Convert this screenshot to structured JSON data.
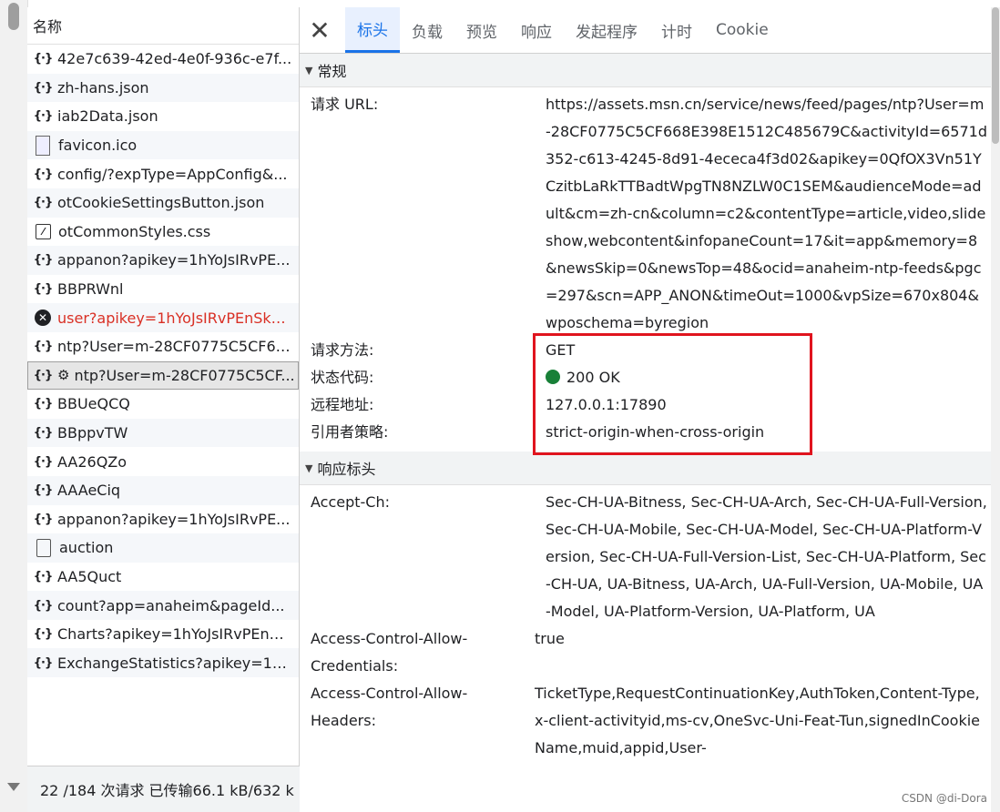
{
  "request_list": {
    "header": "名称",
    "items": [
      {
        "icon": "braces-icon",
        "name": "42e7c639-42ed-4e0f-936c-e7f..."
      },
      {
        "icon": "braces-icon",
        "name": "zh-hans.json"
      },
      {
        "icon": "braces-icon",
        "name": "iab2Data.json"
      },
      {
        "icon": "favicon-file-icon",
        "name": "favicon.ico"
      },
      {
        "icon": "braces-icon",
        "name": "config/?expType=AppConfig&..."
      },
      {
        "icon": "braces-icon",
        "name": "otCookieSettingsButton.json"
      },
      {
        "icon": "css-file-icon",
        "name": "otCommonStyles.css"
      },
      {
        "icon": "braces-icon",
        "name": "appanon?apikey=1hYoJsIRvPE..."
      },
      {
        "icon": "braces-icon",
        "name": "BBPRWnl"
      },
      {
        "icon": "error-icon",
        "name": "user?apikey=1hYoJsIRvPEnSkk...",
        "error": true
      },
      {
        "icon": "braces-icon",
        "name": "ntp?User=m-28CF0775C5CF66..."
      },
      {
        "icon": "braces-icon",
        "name": "ntp?User=m-28CF0775C5CF...",
        "selected": true,
        "gear": "⚙"
      },
      {
        "icon": "braces-icon",
        "name": "BBUeQCQ"
      },
      {
        "icon": "braces-icon",
        "name": "BBppvTW"
      },
      {
        "icon": "braces-icon",
        "name": "AA26QZo"
      },
      {
        "icon": "braces-icon",
        "name": "AAAeCiq"
      },
      {
        "icon": "braces-icon",
        "name": "appanon?apikey=1hYoJsIRvPE..."
      },
      {
        "icon": "document-icon",
        "name": "auction"
      },
      {
        "icon": "braces-icon",
        "name": "AA5Quct"
      },
      {
        "icon": "braces-icon",
        "name": "count?app=anaheim&pageId..."
      },
      {
        "icon": "braces-icon",
        "name": "Charts?apikey=1hYoJsIRvPEnS..."
      },
      {
        "icon": "braces-icon",
        "name": "ExchangeStatistics?apikey=1hY..."
      }
    ],
    "footer": "22 /184 次请求  已传输66.1 kB/632 k"
  },
  "tabs": [
    "标头",
    "负载",
    "预览",
    "响应",
    "发起程序",
    "计时",
    "Cookie"
  ],
  "active_tab": "标头",
  "general": {
    "title": "常规",
    "rows": [
      {
        "key": "请求 URL:",
        "value": "https://assets.msn.cn/service/news/feed/pages/ntp?User=m-28CF0775C5CF668E398E1512C485679C&activityId=6571d352-c613-4245-8d91-4ececa4f3d02&apikey=0QfOX3Vn51YCzitbLaRkTTBadtWpgTN8NZLW0C1SEM&audienceMode=adult&cm=zh-cn&column=c2&contentType=article,video,slideshow,webcontent&infopaneCount=17&it=app&memory=8&newsSkip=0&newsTop=48&ocid=anaheim-ntp-feeds&pgc=297&scn=APP_ANON&timeOut=1000&vpSize=670x804&wposchema=byregion"
      },
      {
        "key": "请求方法:",
        "value": "GET"
      },
      {
        "key": "状态代码:",
        "value": "200 OK",
        "status_color": "#188038"
      },
      {
        "key": "远程地址:",
        "value": "127.0.0.1:17890"
      },
      {
        "key": "引用者策略:",
        "value": "strict-origin-when-cross-origin"
      }
    ]
  },
  "response_headers": {
    "title": "响应标头",
    "rows": [
      {
        "key": "Accept-Ch:",
        "value": "Sec-CH-UA-Bitness, Sec-CH-UA-Arch, Sec-CH-UA-Full-Version, Sec-CH-UA-Mobile, Sec-CH-UA-Model, Sec-CH-UA-Platform-Version, Sec-CH-UA-Full-Version-List, Sec-CH-UA-Platform, Sec-CH-UA, UA-Bitness, UA-Arch, UA-Full-Version, UA-Mobile, UA-Model, UA-Platform-Version, UA-Platform, UA"
      },
      {
        "key": "Access-Control-Allow-Credentials:",
        "value": "true"
      },
      {
        "key": "Access-Control-Allow-Headers:",
        "value": "TicketType,RequestContinuationKey,AuthToken,Content-Type,x-client-activityid,ms-cv,OneSvc-Uni-Feat-Tun,signedInCookieName,muid,appid,User-"
      }
    ]
  },
  "watermark": "CSDN @di-Dora",
  "colors": {
    "accent": "#1a73e8",
    "highlight_border": "#e0141e",
    "error_text": "#d93025"
  }
}
